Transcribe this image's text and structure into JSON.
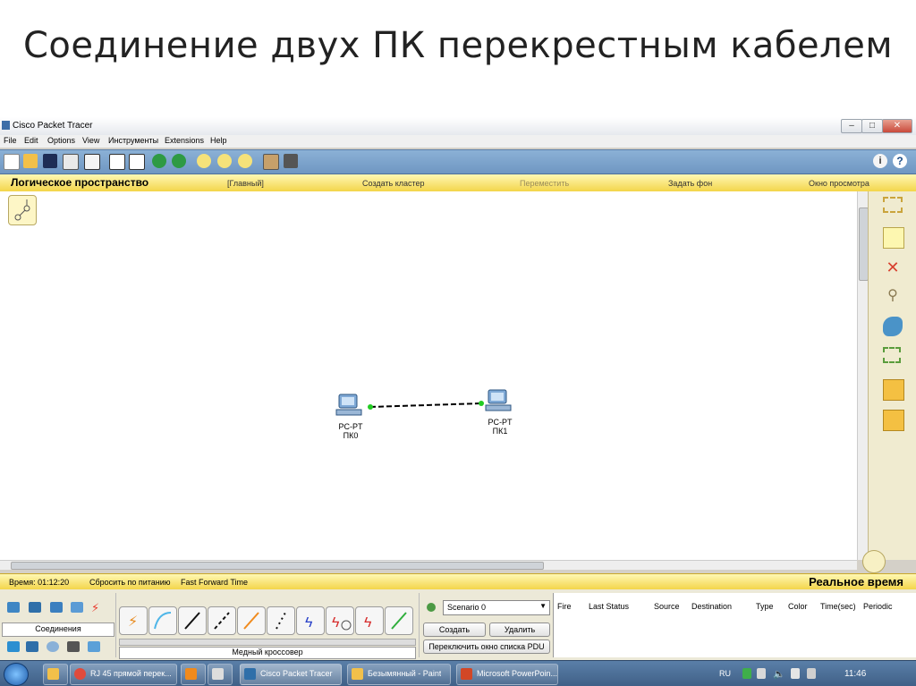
{
  "slide": {
    "title": "Соединение двух ПК перекрестным кабелем"
  },
  "window": {
    "title": "Cisco Packet Tracer"
  },
  "menu": [
    "File",
    "Edit",
    "Options",
    "View",
    "Инструменты",
    "Extensions",
    "Help"
  ],
  "workspace_bar": {
    "logical": "Логическое пространство",
    "main": "[Главный]",
    "cluster": "Создать кластер",
    "move": "Переместить",
    "background": "Задать фон",
    "viewport": "Окно просмотра"
  },
  "devices": [
    {
      "model": "PC-PT",
      "name": "ПК0"
    },
    {
      "model": "PC-PT",
      "name": "ПК1"
    }
  ],
  "statusbar": {
    "time": "Время: 01:12:20",
    "power": "Сбросить по питанию",
    "fast_forward": "Fast Forward Time",
    "mode": "Реальное время"
  },
  "device_panel": {
    "category_label": "Соединения",
    "cable_label": "Медный кроссовер"
  },
  "scenario": {
    "selected": "Scenario 0",
    "create": "Создать",
    "delete": "Удалить",
    "toggle": "Переключить окно списка PDU"
  },
  "pdu_columns": [
    "Fire",
    "Last Status",
    "Source",
    "Destination",
    "Type",
    "Color",
    "Time(sec)",
    "Periodic"
  ],
  "taskbar": {
    "items": [
      "RJ 45 прямой перек...",
      "Cisco Packet Tracer",
      "Безымянный - Paint",
      "Microsoft PowerPoin..."
    ],
    "lang": "RU",
    "clock": "11:46"
  },
  "colors": {
    "toolbar": "#7aa2cc",
    "workspace_bar": "#f6dc5a",
    "link": "#000000",
    "port": "#22cc22"
  }
}
